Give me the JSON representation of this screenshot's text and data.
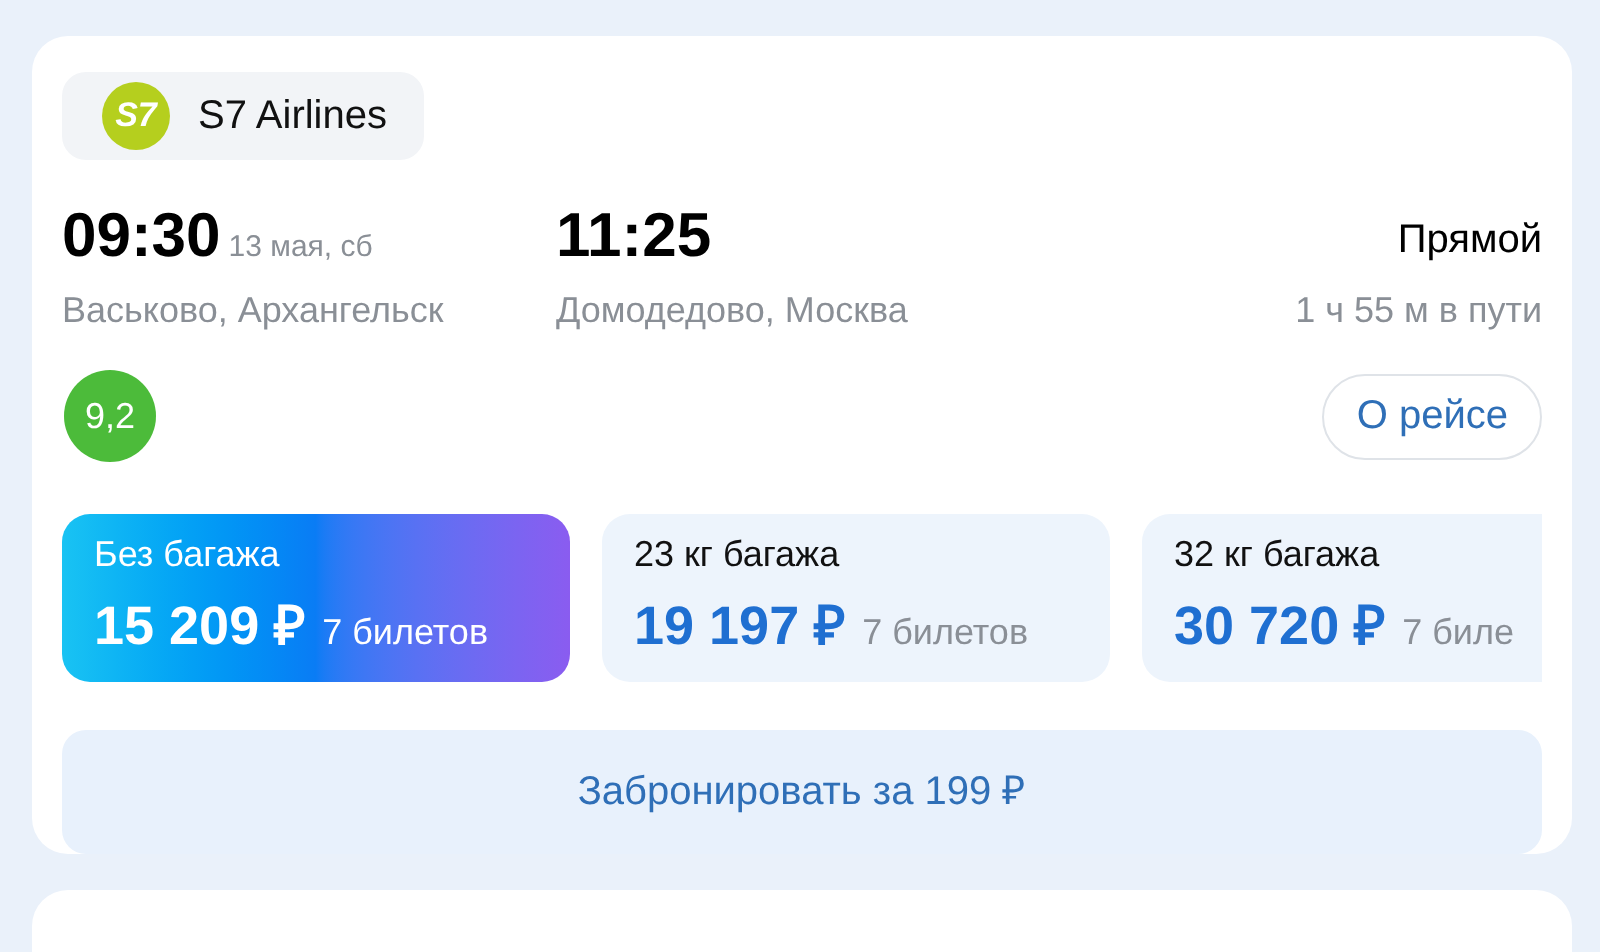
{
  "airline": {
    "name": "S7 Airlines",
    "logo_text": "S7"
  },
  "departure": {
    "time": "09:30",
    "date": "13 мая, сб",
    "place": "Васьково, Архангельск"
  },
  "arrival": {
    "time": "11:25",
    "place": "Домодедово, Москва"
  },
  "route": {
    "type": "Прямой",
    "duration": "1 ч 55 м в пути"
  },
  "rating": "9,2",
  "details_button": "О рейсе",
  "fares": [
    {
      "label": "Без багажа",
      "price": "15 209 ₽",
      "tickets": "7 билетов",
      "selected": true
    },
    {
      "label": "23 кг багажа",
      "price": "19 197 ₽",
      "tickets": "7 билетов",
      "selected": false
    },
    {
      "label": "32 кг багажа",
      "price": "30 720 ₽",
      "tickets": "7 биле",
      "selected": false
    }
  ],
  "book_button": "Забронировать за 199 ₽"
}
